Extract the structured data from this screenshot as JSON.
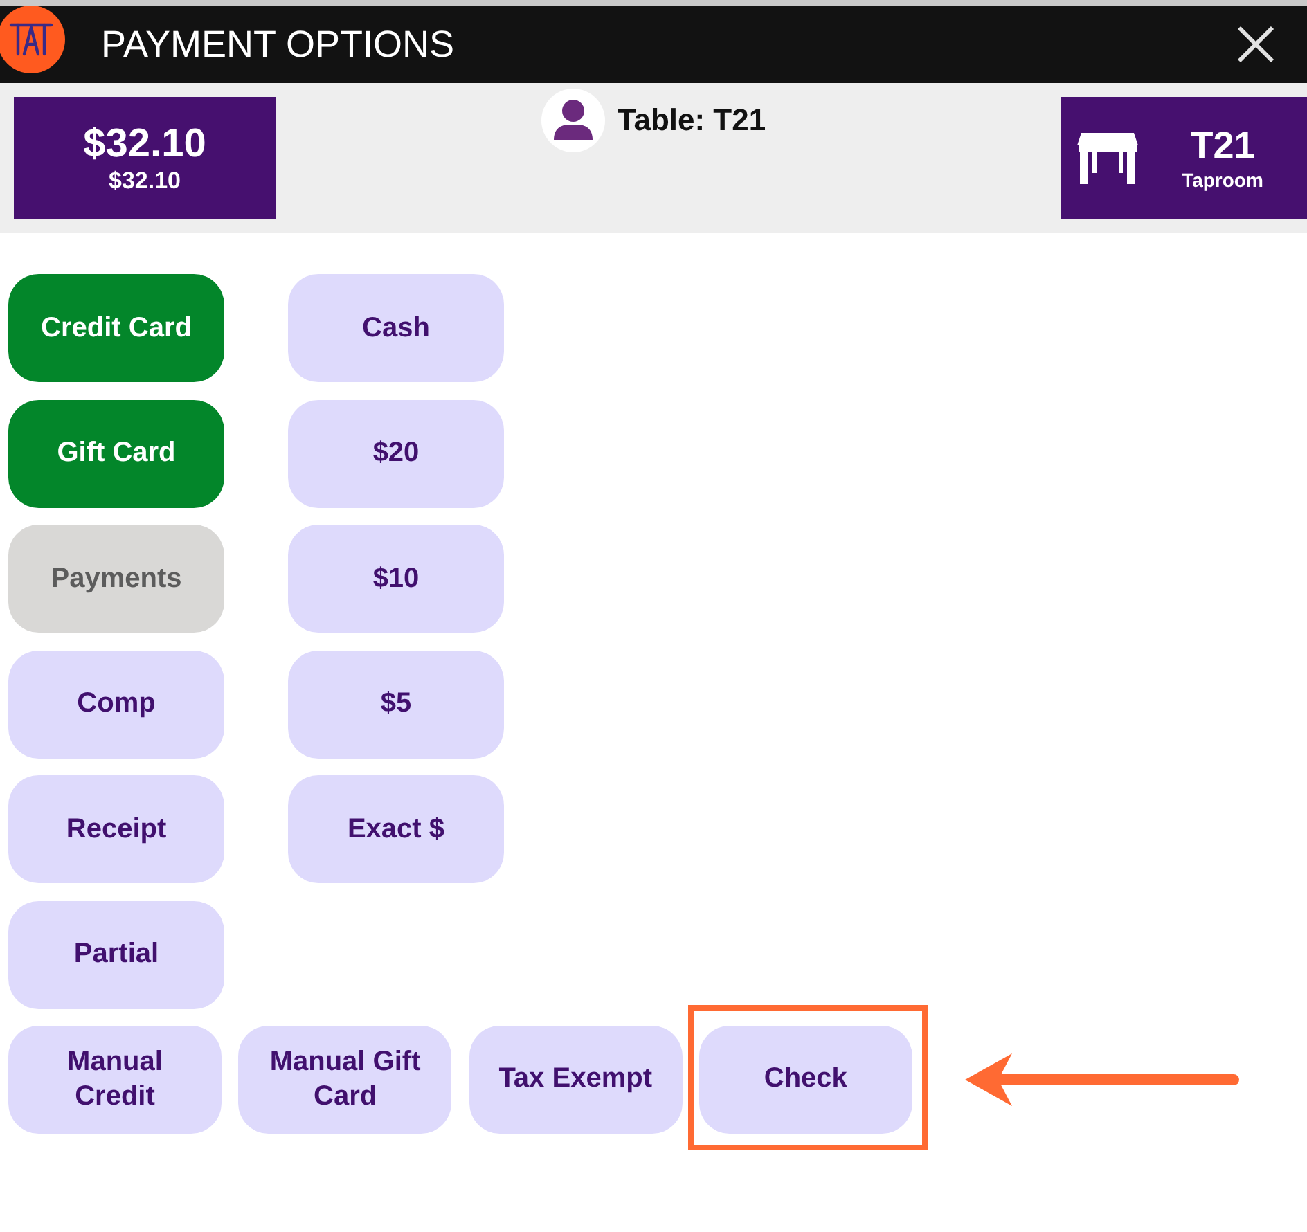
{
  "window": {
    "title": "PAYMENT OPTIONS"
  },
  "header": {
    "amount_panel": {
      "total": "$32.10",
      "subtotal": "$32.10"
    },
    "table_label": "Table: T21",
    "table_panel": {
      "table": "T21",
      "area": "Taproom"
    }
  },
  "button_columns": [
    [
      {
        "label": "Credit Card",
        "kind": "primary",
        "disabled": false,
        "highlighted": false
      },
      {
        "label": "Gift Card",
        "kind": "primary",
        "disabled": false,
        "highlighted": false
      },
      {
        "label": "Payments",
        "kind": "secondary",
        "disabled": true,
        "highlighted": false
      },
      {
        "label": "Comp",
        "kind": "secondary",
        "disabled": false,
        "highlighted": false
      },
      {
        "label": "Receipt",
        "kind": "secondary",
        "disabled": false,
        "highlighted": false
      },
      {
        "label": "Partial",
        "kind": "secondary",
        "disabled": false,
        "highlighted": false
      }
    ],
    [
      {
        "label": "Cash",
        "kind": "secondary",
        "disabled": false,
        "highlighted": false
      },
      {
        "label": "$20",
        "kind": "secondary",
        "disabled": false,
        "highlighted": false
      },
      {
        "label": "$10",
        "kind": "secondary",
        "disabled": false,
        "highlighted": false
      },
      {
        "label": "$5",
        "kind": "secondary",
        "disabled": false,
        "highlighted": false
      },
      {
        "label": "Exact $",
        "kind": "secondary",
        "disabled": false,
        "highlighted": false
      }
    ]
  ],
  "bottom_row": [
    {
      "label": "Manual Credit",
      "kind": "secondary",
      "disabled": false,
      "highlighted": false
    },
    {
      "label": "Manual Gift Card",
      "kind": "secondary",
      "disabled": false,
      "highlighted": false
    },
    {
      "label": "Tax Exempt",
      "kind": "secondary",
      "disabled": false,
      "highlighted": false
    },
    {
      "label": "Check",
      "kind": "secondary",
      "disabled": false,
      "highlighted": true
    }
  ]
}
